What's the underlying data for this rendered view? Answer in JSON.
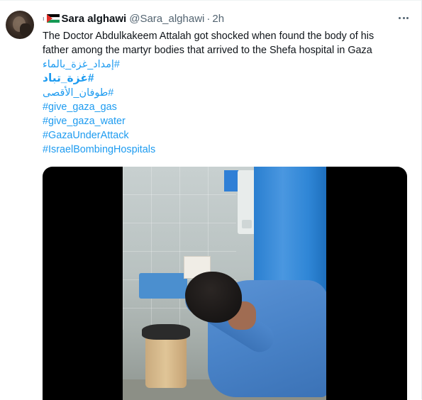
{
  "tweet": {
    "author_name": "Sara alghawi",
    "author_handle": "@Sara_alghawi",
    "separator": "·",
    "time": "2h",
    "pre_marker": "ı",
    "text_lines": [
      "The Doctor Abdulkakeem Attalah got shocked when found the body of his",
      "father among the martyr bodies that arrived to the Shefa hospital in Gaza"
    ],
    "hashtags": [
      "#إمداد_غزة_بالماء",
      "#غزة_تباد",
      "#طوفان_الأقصى",
      "#give_gaza_gas",
      "#give_gaza_water",
      "#GazaUnderAttack",
      "#IsraelBombingHospitals"
    ]
  },
  "colors": {
    "link": "#1d9bf0",
    "text": "#0f1419",
    "secondary": "#536471",
    "media_bg": "#000000"
  },
  "icons": {
    "flag": "palestine-flag-emoji",
    "more": "more-options-icon"
  }
}
